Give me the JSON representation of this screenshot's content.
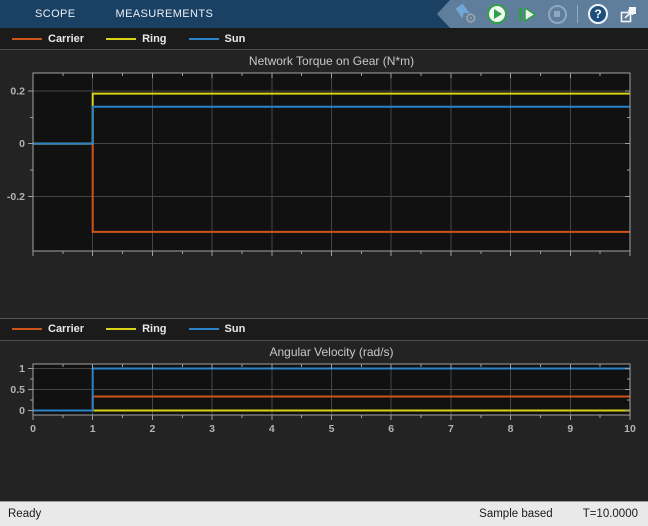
{
  "toolbar": {
    "tabs": [
      "SCOPE",
      "MEASUREMENTS"
    ],
    "icons": [
      "simulation-settings-icon",
      "run-icon",
      "step-forward-icon",
      "stop-icon",
      "help-icon",
      "popout-icon"
    ]
  },
  "statusbar": {
    "status": "Ready",
    "mode": "Sample based",
    "time": "T=10.0000"
  },
  "colors": {
    "carrier": "#D05319",
    "ring": "#D8D314",
    "sun": "#2A83C9",
    "toolbar_bg": "#1A4063",
    "icon_panel_bg": "#5F7E9C",
    "panel_bg": "#232323",
    "legend_bg": "#1B1B1B",
    "axes_bg": "#111111",
    "grid": "#454545",
    "tick": "#9E9E9E",
    "border": "#A3A3A3",
    "title_text": "#C9C9C9",
    "tick_text": "#B3B3B3",
    "legend_text": "#E8E8E8",
    "status_bg": "#E9E9E9"
  },
  "chart_data": [
    {
      "type": "line",
      "title": "Network Torque on Gear (N*m)",
      "xlabel": "",
      "ylabel": "",
      "xlim": [
        0,
        10
      ],
      "ylim": [
        -0.4075,
        0.268
      ],
      "xticks": [
        0,
        1,
        2,
        3,
        4,
        5,
        6,
        7,
        8,
        9,
        10
      ],
      "x_tick_labels_visible": false,
      "yticks": [
        {
          "v": 0.2,
          "label": "0.2"
        },
        {
          "v": 0,
          "label": "0"
        },
        {
          "v": -0.2,
          "label": "-0.2"
        }
      ],
      "grid": true,
      "legend_position": "top-strip",
      "legend": [
        {
          "name": "Carrier",
          "color": "#D05319"
        },
        {
          "name": "Ring",
          "color": "#D8D314"
        },
        {
          "name": "Sun",
          "color": "#2A83C9"
        }
      ],
      "series": [
        {
          "name": "Carrier",
          "color": "#D05319",
          "points": [
            [
              0,
              0
            ],
            [
              1,
              0
            ],
            [
              1,
              -0.335
            ],
            [
              10,
              -0.335
            ]
          ]
        },
        {
          "name": "Ring",
          "color": "#D8D314",
          "points": [
            [
              0,
              0
            ],
            [
              1,
              0
            ],
            [
              1,
              0.19
            ],
            [
              10,
              0.19
            ]
          ]
        },
        {
          "name": "Sun",
          "color": "#2A83C9",
          "points": [
            [
              0,
              0
            ],
            [
              1,
              0
            ],
            [
              1,
              0.14
            ],
            [
              10,
              0.14
            ]
          ]
        }
      ]
    },
    {
      "type": "line",
      "title": "Angular Velocity (rad/s)",
      "xlabel": "",
      "ylabel": "",
      "xlim": [
        0,
        10
      ],
      "ylim": [
        -0.108,
        1.108
      ],
      "xticks": [
        0,
        1,
        2,
        3,
        4,
        5,
        6,
        7,
        8,
        9,
        10
      ],
      "x_tick_labels_visible": true,
      "yticks": [
        {
          "v": 1,
          "label": "1"
        },
        {
          "v": 0.5,
          "label": "0.5"
        },
        {
          "v": 0,
          "label": "0"
        }
      ],
      "grid": true,
      "legend_position": "top-strip",
      "legend": [
        {
          "name": "Carrier",
          "color": "#D05319"
        },
        {
          "name": "Ring",
          "color": "#D8D314"
        },
        {
          "name": "Sun",
          "color": "#2A83C9"
        }
      ],
      "series": [
        {
          "name": "Carrier",
          "color": "#D05319",
          "points": [
            [
              0,
              0
            ],
            [
              1,
              0
            ],
            [
              1,
              0.333
            ],
            [
              10,
              0.333
            ]
          ]
        },
        {
          "name": "Ring",
          "color": "#D8D314",
          "points": [
            [
              0,
              0
            ],
            [
              10,
              0
            ]
          ]
        },
        {
          "name": "Sun",
          "color": "#2A83C9",
          "points": [
            [
              0,
              0
            ],
            [
              1,
              0
            ],
            [
              1,
              1
            ],
            [
              10,
              1
            ]
          ]
        }
      ]
    }
  ]
}
